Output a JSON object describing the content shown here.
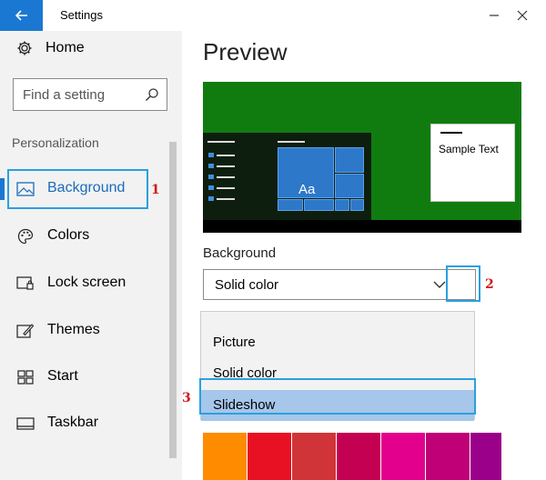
{
  "window": {
    "title": "Settings",
    "back_icon": "arrow-left-icon",
    "minimize_icon": "minimize-icon",
    "close_icon": "close-icon"
  },
  "sidebar": {
    "home_label": "Home",
    "search_placeholder": "Find a setting",
    "section_header": "Personalization",
    "items": [
      {
        "label": "Background",
        "icon": "picture-icon",
        "selected": true
      },
      {
        "label": "Colors",
        "icon": "palette-icon",
        "selected": false
      },
      {
        "label": "Lock screen",
        "icon": "lock-screen-icon",
        "selected": false
      },
      {
        "label": "Themes",
        "icon": "themes-icon",
        "selected": false
      },
      {
        "label": "Start",
        "icon": "start-icon",
        "selected": false
      },
      {
        "label": "Taskbar",
        "icon": "taskbar-icon",
        "selected": false
      }
    ]
  },
  "main": {
    "preview_title": "Preview",
    "sample_text": "Sample Text",
    "tile_text": "Aa",
    "background_label": "Background",
    "dropdown_value": "Solid color",
    "dropdown_options": [
      {
        "label": "Picture",
        "selected": false
      },
      {
        "label": "Solid color",
        "selected": false
      },
      {
        "label": "Slideshow",
        "selected": true
      }
    ],
    "swatch_colors": [
      "#ff8c00",
      "#e81123",
      "#d13438",
      "#c30052",
      "#e3008c",
      "#bf0077",
      "#9a0089",
      "#881798"
    ]
  },
  "annotations": {
    "step1": "1",
    "step2": "2",
    "step3": "3",
    "highlight_color": "#2aa0e0",
    "number_color": "#d01a1a"
  },
  "colors": {
    "accent": "#1a78d3",
    "preview_bg": "#107c10"
  }
}
